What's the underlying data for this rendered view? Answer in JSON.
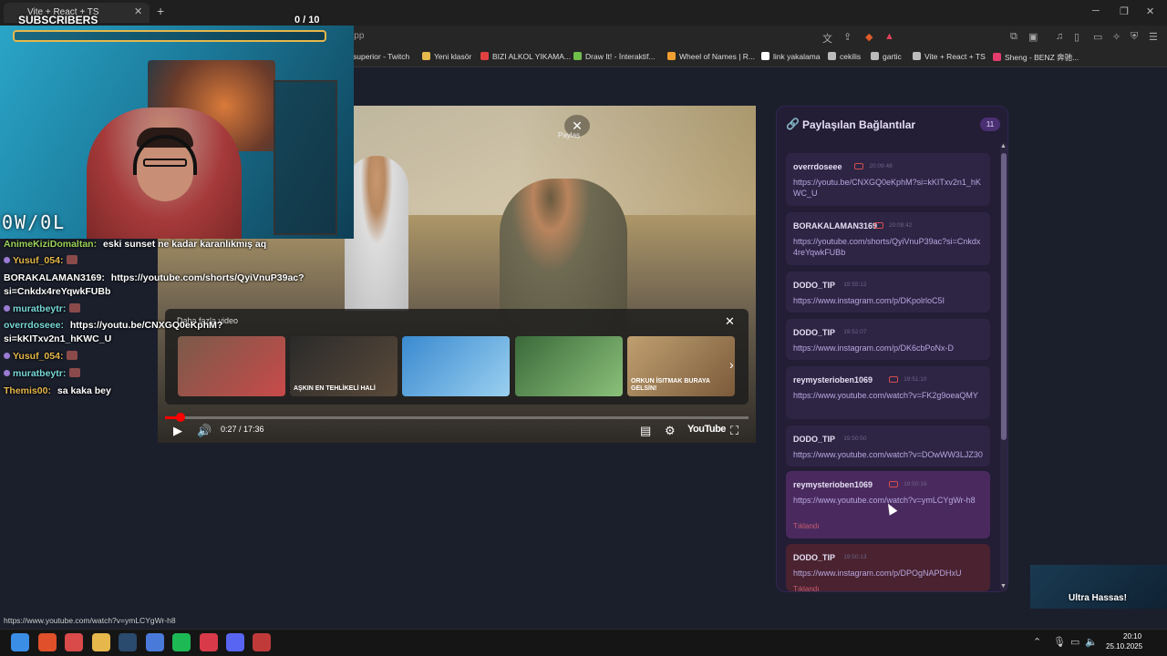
{
  "browser": {
    "tab_title": "Vite + React + TS",
    "new_tab": "+",
    "url": "linkyakalama.netlify.app",
    "bookmarks": [
      {
        "label": "superior - Twitch",
        "color": "#9146ff"
      },
      {
        "label": "Yeni klasör",
        "color": "#e6b84b"
      },
      {
        "label": "BIZI ALKOL YIKAMA...",
        "color": "#e04040"
      },
      {
        "label": "Draw It! - İnteraktif...",
        "color": "#6fbf4a"
      },
      {
        "label": "Wheel of Names | R...",
        "color": "#f0a030"
      },
      {
        "label": "link yakalama",
        "color": "#ffffff"
      },
      {
        "label": "cekilis",
        "color": "#bbbbbb"
      },
      {
        "label": "gartic",
        "color": "#bbbbbb"
      },
      {
        "label": "Vite + React + TS",
        "color": "#bbbbbb"
      },
      {
        "label": "Sheng - BENZ 奔驰...",
        "color": "#e33d6b"
      }
    ]
  },
  "stream_overlay": {
    "subs_label": "SUBSCRIBERS",
    "subs_count": "0  / 10",
    "subs_progress": 0,
    "brand": "0W/0L",
    "overlay_text": "Ultra Hassas!"
  },
  "chat": [
    {
      "name": "AnimeKiziDomaltan:",
      "name_color": "#9bd35a",
      "message": " eski sunset ne kadar karanlıkmış aq",
      "badge": false
    },
    {
      "name": "Yusuf_054:",
      "name_color": "#e6b84b",
      "message": "",
      "badge": true,
      "emote": true
    },
    {
      "name": "BORAKALAMAN3169:",
      "name_color": "#ffffff",
      "message": " https://youtube.com/shorts/QyiVnuP39ac?",
      "badge": false
    },
    {
      "name": "",
      "name_color": "#ffffff",
      "message": "si=Cnkdx4reYqwkFUBb",
      "badge": false
    },
    {
      "name": "muratbeytr:",
      "name_color": "#79d9d9",
      "message": "",
      "badge": true,
      "emote": true
    },
    {
      "name": "overrdoseee:",
      "name_color": "#79d9d9",
      "message": " https://youtu.be/CNXGQ0eKphM?",
      "badge": false
    },
    {
      "name": "",
      "name_color": "#ffffff",
      "message": "si=kKITxv2n1_hKWC_U",
      "badge": false
    },
    {
      "name": "Yusuf_054:",
      "name_color": "#e6b84b",
      "message": "",
      "badge": true,
      "emote": true
    },
    {
      "name": "muratbeytr:",
      "name_color": "#79d9d9",
      "message": "",
      "badge": true,
      "emote": true
    },
    {
      "name": "Themis00:",
      "name_color": "#e6b84b",
      "message": " sa kaka bey",
      "badge": false
    }
  ],
  "player": {
    "share_label": "Paylaş",
    "more_videos_label": "Daha fazla video",
    "time": "0:27 / 17:36",
    "progress": 0.026,
    "youtube_label": "YouTube",
    "thumbnails": [
      {
        "caption": "",
        "colors": [
          "#7a5a4a",
          "#c84a4a"
        ]
      },
      {
        "caption": "AŞKIN EN TEHLİKELİ HALİ",
        "colors": [
          "#2a2a2a",
          "#5a4a3a"
        ]
      },
      {
        "caption": "",
        "colors": [
          "#3a8ad0",
          "#9ad0f0"
        ]
      },
      {
        "caption": "",
        "colors": [
          "#3a6a3a",
          "#8bc07a"
        ]
      },
      {
        "caption": "ORKUN İSITMAK BURAYA GELSİN!",
        "colors": [
          "#c0a070",
          "#7a5a3a"
        ]
      }
    ]
  },
  "sidebar": {
    "title": "Paylaşılan Bağlantılar",
    "count": "11",
    "links": [
      {
        "user": "overrdoseee",
        "time": "20:09:48",
        "youtube": true,
        "url": "https://youtu.be/CNXGQ0eKphM?si=kKITxv2n1_hKWC_U",
        "clicked": false
      },
      {
        "user": "BORAKALAMAN3169",
        "time": "20:08:42",
        "youtube": true,
        "url": "https://youtube.com/shorts/QyiVnuP39ac?si=Cnkdx4reYqwkFUBb",
        "clicked": false
      },
      {
        "user": "DODO_TIP",
        "time": "19:55:12",
        "youtube": false,
        "url": "https://www.instagram.com/p/DKpolrloC5I",
        "clicked": false
      },
      {
        "user": "DODO_TIP",
        "time": "19:52:07",
        "youtube": false,
        "url": "https://www.instagram.com/p/DK6cbPoNx-D",
        "clicked": false
      },
      {
        "user": "reymysterioben1069",
        "time": "19:51:10",
        "youtube": true,
        "url": "https://www.youtube.com/watch?v=FK2g9oeaQMY",
        "clicked": false
      },
      {
        "user": "DODO_TIP",
        "time": "19:50:50",
        "youtube": false,
        "url": "https://www.youtube.com/watch?v=DOwWW3LJZ30",
        "clicked": false
      },
      {
        "user": "reymysterioben1069",
        "time": "19:50:16",
        "youtube": true,
        "url": "https://www.youtube.com/watch?v=ymLCYgWr-h8",
        "clicked": true,
        "clicked_label": "Tıklandı"
      },
      {
        "user": "DODO_TIP",
        "time": "19:50:13",
        "youtube": false,
        "url": "https://www.instagram.com/p/DPOgNAPDHxU",
        "clicked": true,
        "clicked_label": "Tıklandı"
      }
    ]
  },
  "status_url": "https://www.youtube.com/watch?v=ymLCYgWr-h8",
  "taskbar": {
    "clock_time": "20:10",
    "clock_date": "25.10.2025",
    "apps": [
      "windows",
      "brave",
      "maps",
      "files",
      "steam",
      "browser",
      "spotify",
      "app-red",
      "discord",
      "news"
    ]
  }
}
